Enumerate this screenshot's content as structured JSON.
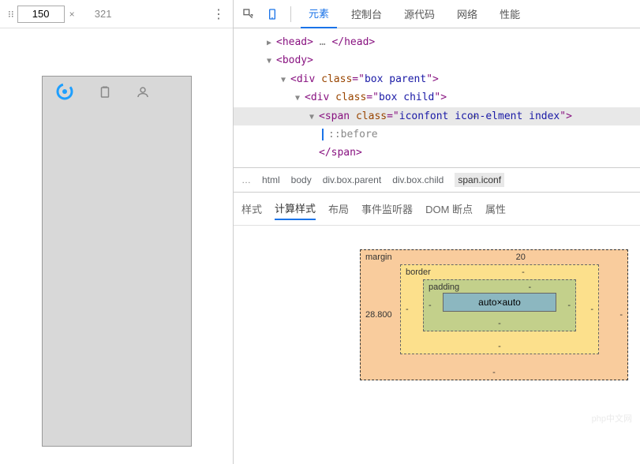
{
  "toolbar": {
    "width": "150",
    "height": "321",
    "x": "×"
  },
  "phone": {
    "logo": "e",
    "clipboard_icon": "📋",
    "person_icon": "👤"
  },
  "tabs": {
    "elements": "元素",
    "console": "控制台",
    "sources": "源代码",
    "network": "网络",
    "performance": "性能"
  },
  "tree": {
    "head_open": "<head>",
    "head_dots": "…",
    "head_close": "</head>",
    "body_open": "<body>",
    "div1_open": "<div ",
    "div1_attr": "class",
    "div1_val": "box parent",
    "div1_close": ">",
    "div2_open": "<div ",
    "div2_attr": "class",
    "div2_val": "box child",
    "div2_close": ">",
    "span_open": "<span ",
    "span_attr": "class",
    "span_val": "iconfont icon-elment index",
    "span_close": ">",
    "before": "::before",
    "span_end": "</span>"
  },
  "breadcrumb": {
    "dots": "…",
    "html": "html",
    "body": "body",
    "div1": "div.box.parent",
    "div2": "div.box.child",
    "span": "span.iconf"
  },
  "styles_tabs": {
    "styles": "样式",
    "computed": "计算样式",
    "layout": "布局",
    "listeners": "事件监听器",
    "dom_bp": "DOM 断点",
    "props": "属性"
  },
  "box_model": {
    "margin_label": "margin",
    "border_label": "border",
    "padding_label": "padding",
    "content": "auto×auto",
    "margin_top": "20",
    "margin_right": "-",
    "margin_bottom": "-",
    "margin_left": "28.800",
    "border_top": "-",
    "border_right": "-",
    "border_bottom": "-",
    "border_left": "-",
    "padding_top": "-",
    "padding_right": "-",
    "padding_bottom": "-",
    "padding_left": "-"
  },
  "watermark": "php中文网"
}
